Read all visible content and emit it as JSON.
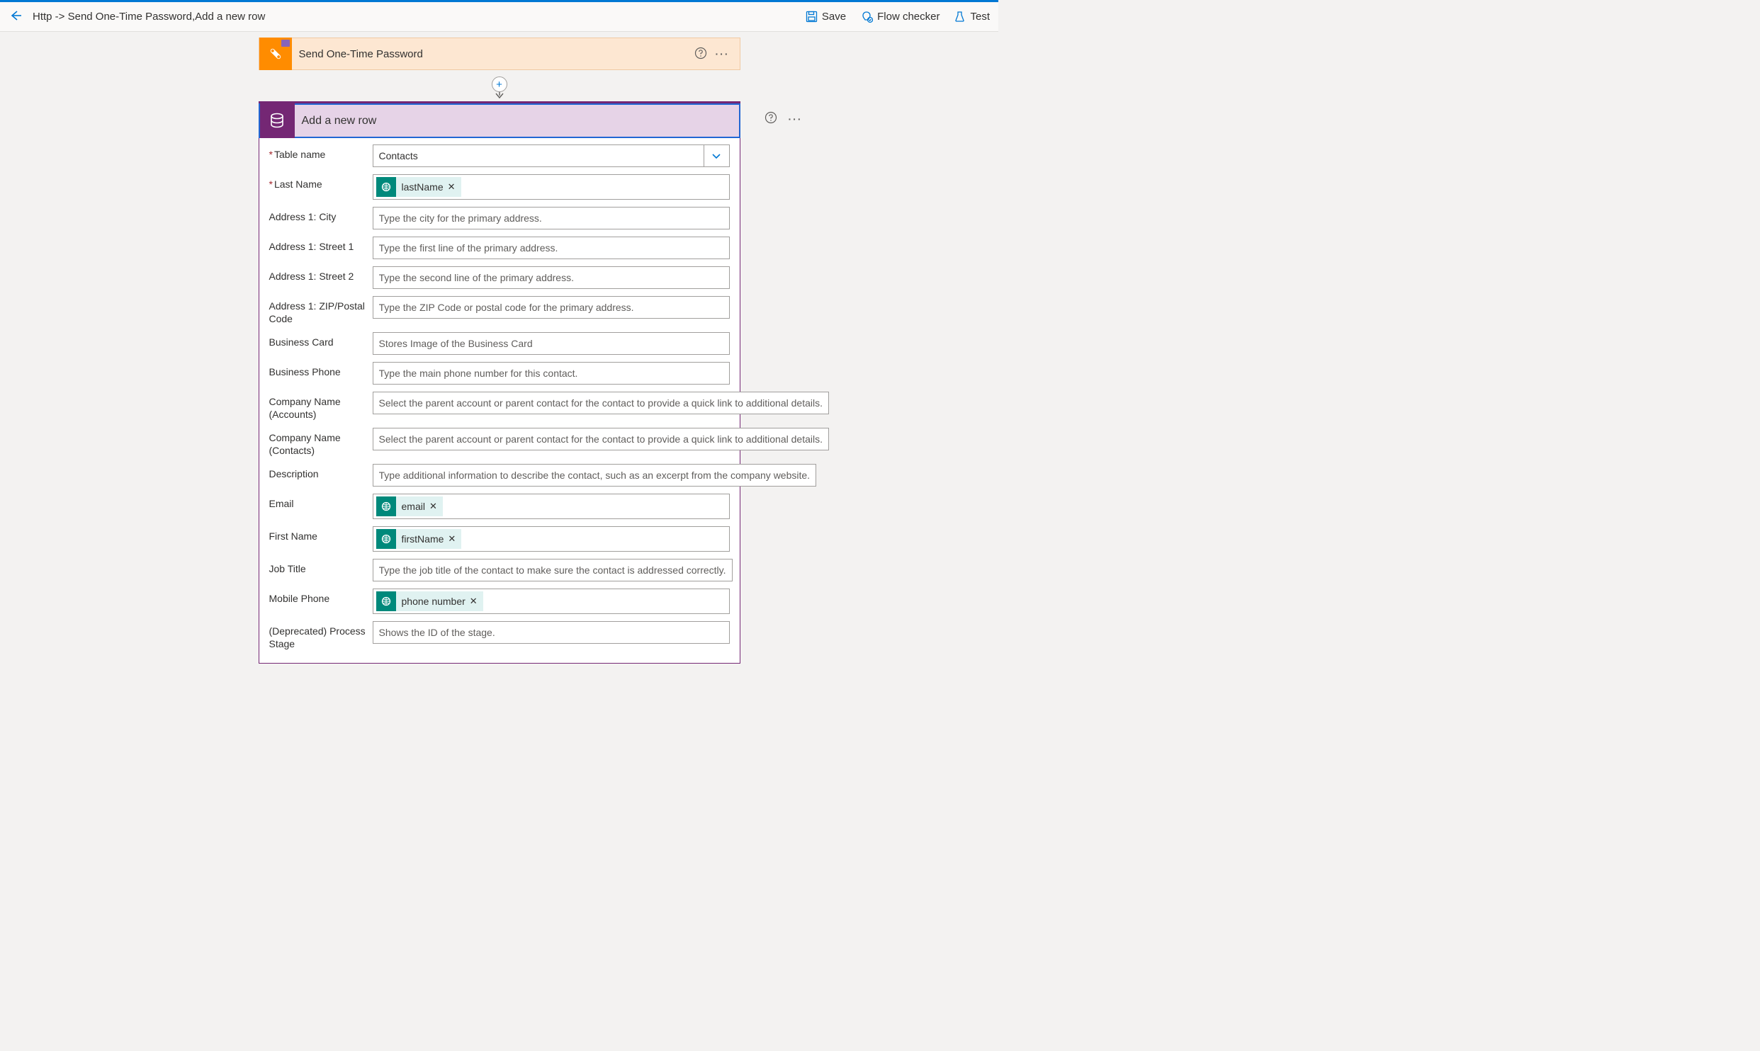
{
  "topbar": {
    "breadcrumb": "Http -> Send One-Time Password,Add a new row",
    "save": "Save",
    "flowchecker": "Flow checker",
    "test": "Test"
  },
  "trigger": {
    "title": "Send One-Time Password"
  },
  "action": {
    "title": "Add a new row",
    "fields": [
      {
        "label": "Table name",
        "required": true,
        "type": "select",
        "value": "Contacts"
      },
      {
        "label": "Last Name",
        "required": true,
        "type": "token",
        "token": "lastName"
      },
      {
        "label": "Address 1: City",
        "required": false,
        "type": "text",
        "placeholder": "Type the city for the primary address."
      },
      {
        "label": "Address 1: Street 1",
        "required": false,
        "type": "text",
        "placeholder": "Type the first line of the primary address."
      },
      {
        "label": "Address 1: Street 2",
        "required": false,
        "type": "text",
        "placeholder": "Type the second line of the primary address."
      },
      {
        "label": "Address 1: ZIP/Postal Code",
        "required": false,
        "type": "text",
        "placeholder": "Type the ZIP Code or postal code for the primary address."
      },
      {
        "label": "Business Card",
        "required": false,
        "type": "text",
        "placeholder": "Stores Image of the Business Card"
      },
      {
        "label": "Business Phone",
        "required": false,
        "type": "text",
        "placeholder": "Type the main phone number for this contact."
      },
      {
        "label": "Company Name (Accounts)",
        "required": false,
        "type": "text",
        "placeholder": "Select the parent account or parent contact for the contact to provide a quick link to additional details."
      },
      {
        "label": "Company Name (Contacts)",
        "required": false,
        "type": "text",
        "placeholder": "Select the parent account or parent contact for the contact to provide a quick link to additional details."
      },
      {
        "label": "Description",
        "required": false,
        "type": "text",
        "placeholder": "Type additional information to describe the contact, such as an excerpt from the company website."
      },
      {
        "label": "Email",
        "required": false,
        "type": "token",
        "token": "email"
      },
      {
        "label": "First Name",
        "required": false,
        "type": "token",
        "token": "firstName"
      },
      {
        "label": "Job Title",
        "required": false,
        "type": "text",
        "placeholder": "Type the job title of the contact to make sure the contact is addressed correctly."
      },
      {
        "label": "Mobile Phone",
        "required": false,
        "type": "token",
        "token": "phone number"
      },
      {
        "label": "(Deprecated) Process Stage",
        "required": false,
        "type": "text",
        "placeholder": "Shows the ID of the stage."
      }
    ]
  }
}
